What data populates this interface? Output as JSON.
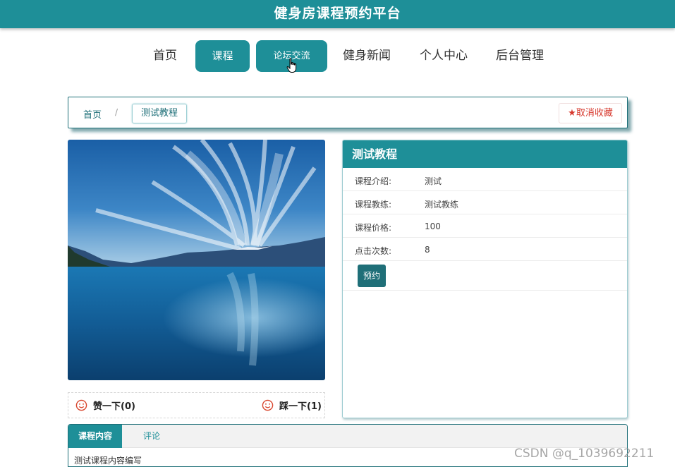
{
  "header": {
    "title": "健身房课程预约平台"
  },
  "nav": {
    "items": [
      "首页",
      "课程",
      "论坛交流",
      "健身新闻",
      "个人中心",
      "后台管理"
    ]
  },
  "breadcrumb": {
    "home": "首页",
    "separator": "/",
    "current": "测试教程"
  },
  "favorite": {
    "label": "取消收藏",
    "icon": "star-icon"
  },
  "course": {
    "title": "测试教程",
    "fields": [
      {
        "label": "课程介绍:",
        "value": "测试"
      },
      {
        "label": "课程教练:",
        "value": "测试教练"
      },
      {
        "label": "课程价格:",
        "value": "100"
      },
      {
        "label": "点击次数:",
        "value": "8"
      }
    ],
    "book_label": "预约"
  },
  "votes": {
    "like_label": "赞一下(0)",
    "dislike_label": "踩一下(1)"
  },
  "tabs": {
    "items": [
      "课程内容",
      "评论"
    ],
    "content": "测试课程内容编写"
  },
  "watermark": "CSDN @q_1039692211",
  "colors": {
    "accent": "#1e8f98",
    "dark_accent": "#1f6f78",
    "favorite_red": "#d73a2f"
  }
}
